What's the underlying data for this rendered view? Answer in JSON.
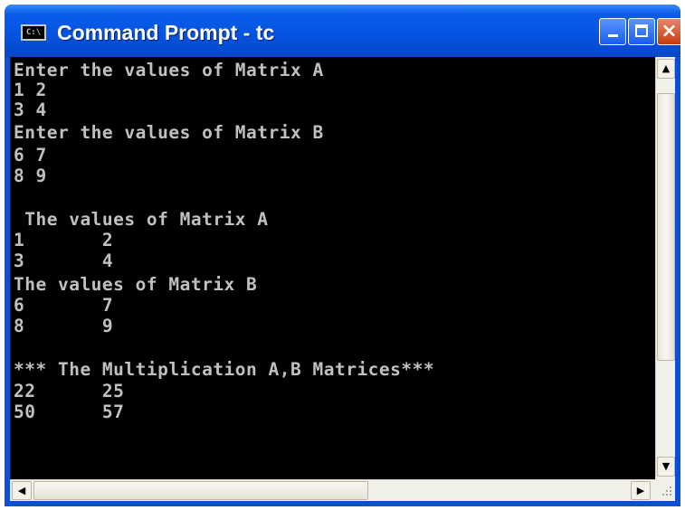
{
  "window": {
    "icon_text": "C:\\",
    "title": "Command Prompt - tc",
    "controls": {
      "minimize": "minimize",
      "maximize": "maximize",
      "close": "×"
    }
  },
  "console": {
    "lines": [
      "Enter the values of Matrix A",
      "1 2",
      "3 4",
      "Enter the values of Matrix B",
      "6 7",
      "8 9",
      "",
      " The values of Matrix A",
      "1       2",
      "3       4",
      "The values of Matrix B",
      "6       7",
      "8       9",
      "",
      "*** The Multiplication A,B Matrices***",
      "22      25",
      "50      57"
    ]
  },
  "scrollbars": {
    "up_arrow": "▲",
    "down_arrow": "▼",
    "left_arrow": "◀",
    "right_arrow": "▶"
  },
  "colors": {
    "console_bg": "#000000",
    "console_text": "#c0c0c0",
    "titlebar": "#0554e3"
  }
}
